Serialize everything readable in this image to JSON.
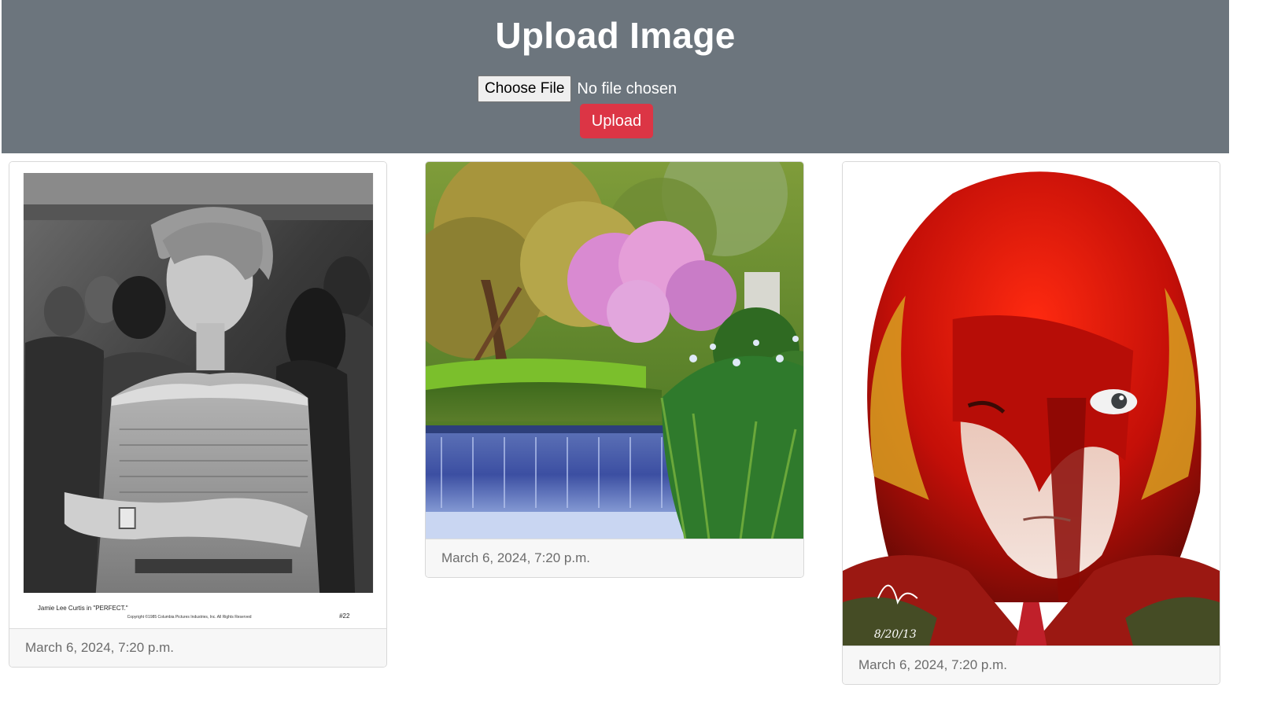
{
  "header": {
    "title": "Upload Image",
    "choose_file_label": "Choose File",
    "file_status": "No file chosen",
    "upload_label": "Upload",
    "background_color": "#6c757d",
    "upload_color": "#dc3545"
  },
  "cards": [
    {
      "image": "black-and-white-photo",
      "caption": "Jamie Lee Curtis in \"PERFECT.\"",
      "number": "#22",
      "copyright": "Copyright ©1985 Columbia Pictures Industries, Inc. All Rights Reserved",
      "timestamp": "March 6, 2024, 7:20 p.m."
    },
    {
      "image": "garden-waterfall-landscape",
      "timestamp": "March 6, 2024, 7:20 p.m."
    },
    {
      "image": "red-haired-anime-illustration",
      "signature": "8/20/13",
      "timestamp": "March 6, 2024, 7:20 p.m."
    }
  ]
}
